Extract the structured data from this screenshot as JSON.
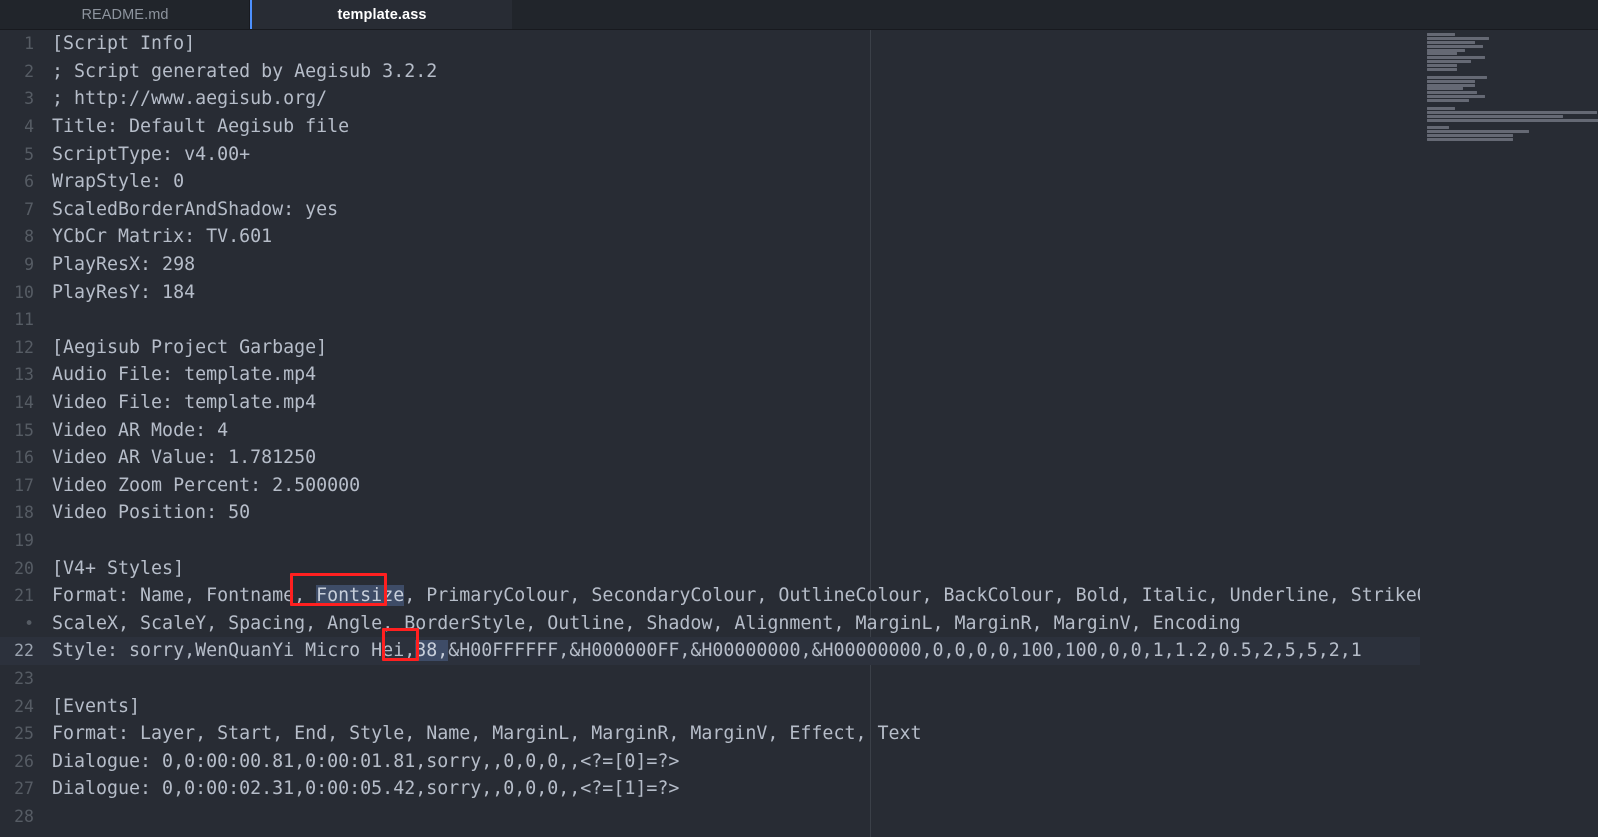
{
  "window": {
    "theme": "dark",
    "accent_color": "#4d90fe",
    "editor_background": "#282c34",
    "tabbar_background": "#21252b",
    "text_color": "#b6bdc9",
    "selection_color": "#3e4c67",
    "annotation_color": "#ff2020",
    "current_line_background": "#2c313c"
  },
  "tabs": [
    {
      "label": "README.md",
      "active": false
    },
    {
      "label": "template.ass",
      "active": true
    }
  ],
  "editor": {
    "active_file": "template.ass",
    "current_line": 22,
    "wrapped_line_marker": "•",
    "lines": [
      {
        "number": "1",
        "text": "[Script Info]"
      },
      {
        "number": "2",
        "text": "; Script generated by Aegisub 3.2.2"
      },
      {
        "number": "3",
        "text": "; http://www.aegisub.org/"
      },
      {
        "number": "4",
        "text": "Title: Default Aegisub file"
      },
      {
        "number": "5",
        "text": "ScriptType: v4.00+"
      },
      {
        "number": "6",
        "text": "WrapStyle: 0"
      },
      {
        "number": "7",
        "text": "ScaledBorderAndShadow: yes"
      },
      {
        "number": "8",
        "text": "YCbCr Matrix: TV.601"
      },
      {
        "number": "9",
        "text": "PlayResX: 298"
      },
      {
        "number": "10",
        "text": "PlayResY: 184"
      },
      {
        "number": "11",
        "text": ""
      },
      {
        "number": "12",
        "text": "[Aegisub Project Garbage]"
      },
      {
        "number": "13",
        "text": "Audio File: template.mp4"
      },
      {
        "number": "14",
        "text": "Video File: template.mp4"
      },
      {
        "number": "15",
        "text": "Video AR Mode: 4"
      },
      {
        "number": "16",
        "text": "Video AR Value: 1.781250"
      },
      {
        "number": "17",
        "text": "Video Zoom Percent: 2.500000"
      },
      {
        "number": "18",
        "text": "Video Position: 50"
      },
      {
        "number": "19",
        "text": ""
      },
      {
        "number": "20",
        "text": "[V4+ Styles]"
      },
      {
        "number": "21",
        "text": "Format: Name, Fontname, Fontsize, PrimaryColour, SecondaryColour, OutlineColour, BackColour, Bold, Italic, Underline, StrikeOut,"
      },
      {
        "number": "•",
        "text": "ScaleX, ScaleY, Spacing, Angle, BorderStyle, Outline, Shadow, Alignment, MarginL, MarginR, MarginV, Encoding"
      },
      {
        "number": "22",
        "text": "Style: sorry,WenQuanYi Micro Hei,38,&H00FFFFFF,&H000000FF,&H00000000,&H00000000,0,0,0,0,100,100,0,0,1,1.2,0.5,2,5,5,2,1"
      },
      {
        "number": "23",
        "text": ""
      },
      {
        "number": "24",
        "text": "[Events]"
      },
      {
        "number": "25",
        "text": "Format: Layer, Start, End, Style, Name, MarginL, MarginR, MarginV, Effect, Text"
      },
      {
        "number": "26",
        "text": "Dialogue: 0,0:00:00.81,0:00:01.81,sorry,,0,0,0,,<?=[0]=?>"
      },
      {
        "number": "27",
        "text": "Dialogue: 0,0:00:02.31,0:00:05.42,sorry,,0,0,0,,<?=[1]=?>"
      },
      {
        "number": "28",
        "text": ""
      }
    ]
  },
  "highlights": {
    "fontsize_keyword": {
      "line": "21",
      "prefix": "Format: Name, Fontname, ",
      "selected": "Fontsize",
      "suffix": ", PrimaryColour, SecondaryColour, OutlineColour, BackColour, Bold, Italic, Underline, StrikeOut,"
    },
    "fontsize_value": {
      "line": "22",
      "prefix": "Style: sorry,WenQuanYi Micro Hei,",
      "selected": "38,",
      "suffix": "&H00FFFFFF,&H000000FF,&H00000000,&H00000000,0,0,0,0,100,100,0,0,1,1.2,0.5,2,5,5,2,1"
    }
  },
  "annotations": [
    {
      "name": "fontsize-keyword-box",
      "label": "Fontsize"
    },
    {
      "name": "fontsize-value-box",
      "label": "38,"
    }
  ],
  "minimap": {
    "present": true,
    "line_widths": [
      28,
      62,
      48,
      56,
      38,
      30,
      58,
      44,
      30,
      30,
      0,
      60,
      48,
      48,
      36,
      50,
      58,
      42,
      0,
      28,
      170,
      136,
      180,
      0,
      22,
      102,
      86,
      86,
      0
    ]
  }
}
